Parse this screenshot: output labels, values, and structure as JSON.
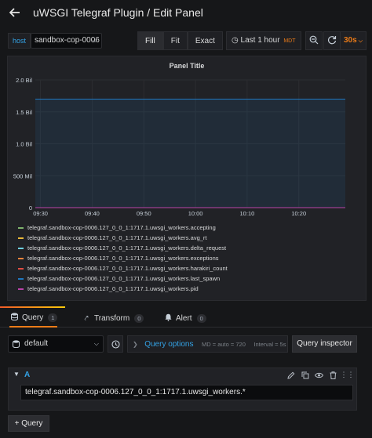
{
  "header": {
    "title": "uWSGI Telegraf Plugin / Edit Panel"
  },
  "toolbar": {
    "var_label": "host",
    "var_value": "sandbox-cop-0006",
    "fill_label": "Fill",
    "fit_label": "Fit",
    "exact_label": "Exact",
    "time_range": "Last 1 hour",
    "timezone": "MDT",
    "refresh_interval": "30s"
  },
  "panel": {
    "title": "Panel Title",
    "legend": [
      {
        "label": "telegraf.sandbox-cop-0006.127_0_0_1:1717.1.uwsgi_workers.accepting",
        "color": "#7eb26d"
      },
      {
        "label": "telegraf.sandbox-cop-0006.127_0_0_1:1717.1.uwsgi_workers.avg_rt",
        "color": "#eab839"
      },
      {
        "label": "telegraf.sandbox-cop-0006.127_0_0_1:1717.1.uwsgi_workers.delta_request",
        "color": "#6ed0e0"
      },
      {
        "label": "telegraf.sandbox-cop-0006.127_0_0_1:1717.1.uwsgi_workers.exceptions",
        "color": "#ef843c"
      },
      {
        "label": "telegraf.sandbox-cop-0006.127_0_0_1:1717.1.uwsgi_workers.harakiri_count",
        "color": "#e24d42"
      },
      {
        "label": "telegraf.sandbox-cop-0006.127_0_0_1:1717.1.uwsgi_workers.last_spawn",
        "color": "#1f78c1"
      },
      {
        "label": "telegraf.sandbox-cop-0006.127_0_0_1:1717.1.uwsgi_workers.pid",
        "color": "#ba43a9"
      }
    ]
  },
  "chart_data": {
    "type": "line",
    "title": "Panel Title",
    "x_ticks": [
      "09:30",
      "09:40",
      "09:50",
      "10:00",
      "10:10",
      "10:20"
    ],
    "y_ticks": [
      "0",
      "500 Mil",
      "1.0 Bil",
      "1.5 Bil",
      "2.0 Bil"
    ],
    "ylim": [
      0,
      2000000000
    ],
    "xlim": [
      "09:29",
      "10:29"
    ],
    "grid": true,
    "legend_position": "bottom",
    "series": [
      {
        "name": "telegraf.sandbox-cop-0006.127_0_0_1:1717.1.uwsgi_workers.accepting",
        "color": "#7eb26d",
        "values": [
          0,
          0
        ]
      },
      {
        "name": "telegraf.sandbox-cop-0006.127_0_0_1:1717.1.uwsgi_workers.avg_rt",
        "color": "#eab839",
        "values": [
          0,
          0
        ]
      },
      {
        "name": "telegraf.sandbox-cop-0006.127_0_0_1:1717.1.uwsgi_workers.delta_request",
        "color": "#6ed0e0",
        "values": [
          0,
          0
        ]
      },
      {
        "name": "telegraf.sandbox-cop-0006.127_0_0_1:1717.1.uwsgi_workers.exceptions",
        "color": "#ef843c",
        "values": [
          0,
          0
        ]
      },
      {
        "name": "telegraf.sandbox-cop-0006.127_0_0_1:1717.1.uwsgi_workers.harakiri_count",
        "color": "#e24d42",
        "values": [
          0,
          0
        ]
      },
      {
        "name": "telegraf.sandbox-cop-0006.127_0_0_1:1717.1.uwsgi_workers.last_spawn",
        "color": "#1f78c1",
        "values": [
          1700000000,
          1700000000
        ]
      },
      {
        "name": "telegraf.sandbox-cop-0006.127_0_0_1:1717.1.uwsgi_workers.pid",
        "color": "#ba43a9",
        "values": [
          0,
          0
        ]
      }
    ],
    "x": [
      "09:29",
      "10:29"
    ]
  },
  "tabs": [
    {
      "label": "Query",
      "count": "1",
      "icon": "database-icon"
    },
    {
      "label": "Transform",
      "count": "0",
      "icon": "transform-icon"
    },
    {
      "label": "Alert",
      "count": "0",
      "icon": "bell-icon"
    }
  ],
  "query_row": {
    "datasource": "default",
    "options_label": "Query options",
    "max_datapoints": "MD = auto = 720",
    "interval": "Interval = 5s",
    "inspector_label": "Query inspector"
  },
  "query": {
    "ref_id": "A",
    "text": "telegraf.sandbox-cop-0006.127_0_0_1:1717.1.uwsgi_workers.*"
  },
  "add_query_label": "Query"
}
